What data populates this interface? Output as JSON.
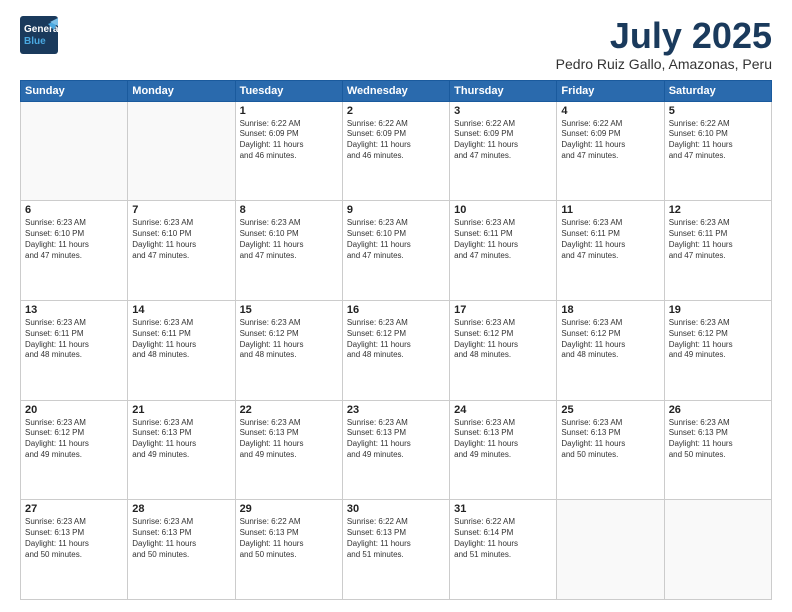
{
  "header": {
    "logo_general": "General",
    "logo_blue": "Blue",
    "month": "July 2025",
    "location": "Pedro Ruiz Gallo, Amazonas, Peru"
  },
  "weekdays": [
    "Sunday",
    "Monday",
    "Tuesday",
    "Wednesday",
    "Thursday",
    "Friday",
    "Saturday"
  ],
  "weeks": [
    [
      {
        "day": "",
        "text": ""
      },
      {
        "day": "",
        "text": ""
      },
      {
        "day": "1",
        "text": "Sunrise: 6:22 AM\nSunset: 6:09 PM\nDaylight: 11 hours\nand 46 minutes."
      },
      {
        "day": "2",
        "text": "Sunrise: 6:22 AM\nSunset: 6:09 PM\nDaylight: 11 hours\nand 46 minutes."
      },
      {
        "day": "3",
        "text": "Sunrise: 6:22 AM\nSunset: 6:09 PM\nDaylight: 11 hours\nand 47 minutes."
      },
      {
        "day": "4",
        "text": "Sunrise: 6:22 AM\nSunset: 6:09 PM\nDaylight: 11 hours\nand 47 minutes."
      },
      {
        "day": "5",
        "text": "Sunrise: 6:22 AM\nSunset: 6:10 PM\nDaylight: 11 hours\nand 47 minutes."
      }
    ],
    [
      {
        "day": "6",
        "text": "Sunrise: 6:23 AM\nSunset: 6:10 PM\nDaylight: 11 hours\nand 47 minutes."
      },
      {
        "day": "7",
        "text": "Sunrise: 6:23 AM\nSunset: 6:10 PM\nDaylight: 11 hours\nand 47 minutes."
      },
      {
        "day": "8",
        "text": "Sunrise: 6:23 AM\nSunset: 6:10 PM\nDaylight: 11 hours\nand 47 minutes."
      },
      {
        "day": "9",
        "text": "Sunrise: 6:23 AM\nSunset: 6:10 PM\nDaylight: 11 hours\nand 47 minutes."
      },
      {
        "day": "10",
        "text": "Sunrise: 6:23 AM\nSunset: 6:11 PM\nDaylight: 11 hours\nand 47 minutes."
      },
      {
        "day": "11",
        "text": "Sunrise: 6:23 AM\nSunset: 6:11 PM\nDaylight: 11 hours\nand 47 minutes."
      },
      {
        "day": "12",
        "text": "Sunrise: 6:23 AM\nSunset: 6:11 PM\nDaylight: 11 hours\nand 47 minutes."
      }
    ],
    [
      {
        "day": "13",
        "text": "Sunrise: 6:23 AM\nSunset: 6:11 PM\nDaylight: 11 hours\nand 48 minutes."
      },
      {
        "day": "14",
        "text": "Sunrise: 6:23 AM\nSunset: 6:11 PM\nDaylight: 11 hours\nand 48 minutes."
      },
      {
        "day": "15",
        "text": "Sunrise: 6:23 AM\nSunset: 6:12 PM\nDaylight: 11 hours\nand 48 minutes."
      },
      {
        "day": "16",
        "text": "Sunrise: 6:23 AM\nSunset: 6:12 PM\nDaylight: 11 hours\nand 48 minutes."
      },
      {
        "day": "17",
        "text": "Sunrise: 6:23 AM\nSunset: 6:12 PM\nDaylight: 11 hours\nand 48 minutes."
      },
      {
        "day": "18",
        "text": "Sunrise: 6:23 AM\nSunset: 6:12 PM\nDaylight: 11 hours\nand 48 minutes."
      },
      {
        "day": "19",
        "text": "Sunrise: 6:23 AM\nSunset: 6:12 PM\nDaylight: 11 hours\nand 49 minutes."
      }
    ],
    [
      {
        "day": "20",
        "text": "Sunrise: 6:23 AM\nSunset: 6:12 PM\nDaylight: 11 hours\nand 49 minutes."
      },
      {
        "day": "21",
        "text": "Sunrise: 6:23 AM\nSunset: 6:13 PM\nDaylight: 11 hours\nand 49 minutes."
      },
      {
        "day": "22",
        "text": "Sunrise: 6:23 AM\nSunset: 6:13 PM\nDaylight: 11 hours\nand 49 minutes."
      },
      {
        "day": "23",
        "text": "Sunrise: 6:23 AM\nSunset: 6:13 PM\nDaylight: 11 hours\nand 49 minutes."
      },
      {
        "day": "24",
        "text": "Sunrise: 6:23 AM\nSunset: 6:13 PM\nDaylight: 11 hours\nand 49 minutes."
      },
      {
        "day": "25",
        "text": "Sunrise: 6:23 AM\nSunset: 6:13 PM\nDaylight: 11 hours\nand 50 minutes."
      },
      {
        "day": "26",
        "text": "Sunrise: 6:23 AM\nSunset: 6:13 PM\nDaylight: 11 hours\nand 50 minutes."
      }
    ],
    [
      {
        "day": "27",
        "text": "Sunrise: 6:23 AM\nSunset: 6:13 PM\nDaylight: 11 hours\nand 50 minutes."
      },
      {
        "day": "28",
        "text": "Sunrise: 6:23 AM\nSunset: 6:13 PM\nDaylight: 11 hours\nand 50 minutes."
      },
      {
        "day": "29",
        "text": "Sunrise: 6:22 AM\nSunset: 6:13 PM\nDaylight: 11 hours\nand 50 minutes."
      },
      {
        "day": "30",
        "text": "Sunrise: 6:22 AM\nSunset: 6:13 PM\nDaylight: 11 hours\nand 51 minutes."
      },
      {
        "day": "31",
        "text": "Sunrise: 6:22 AM\nSunset: 6:14 PM\nDaylight: 11 hours\nand 51 minutes."
      },
      {
        "day": "",
        "text": ""
      },
      {
        "day": "",
        "text": ""
      }
    ]
  ]
}
